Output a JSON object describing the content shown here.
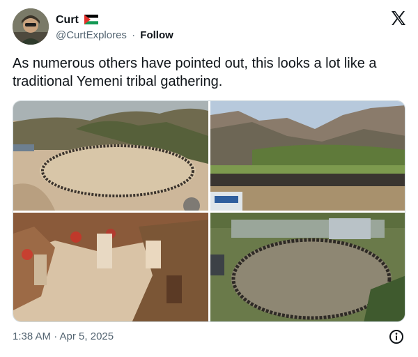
{
  "author": {
    "name": "Curt",
    "flag_icon": "palestine-flag-icon",
    "handle": "@CurtExplores",
    "separator": "·",
    "follow_label": "Follow"
  },
  "tweet": {
    "text": "As numerous others have pointed out, this looks a lot like a traditional Yemeni tribal gathering."
  },
  "media": [
    {
      "description_icon": "photo-icon"
    },
    {
      "description_icon": "photo-icon"
    },
    {
      "description_icon": "photo-icon"
    },
    {
      "description_icon": "photo-icon"
    }
  ],
  "footer": {
    "timestamp": "1:38 AM · Apr 5, 2025",
    "info_icon": "info-icon"
  },
  "colors": {
    "text": "#0f1419",
    "secondary": "#536471",
    "border": "#cfd9de"
  }
}
